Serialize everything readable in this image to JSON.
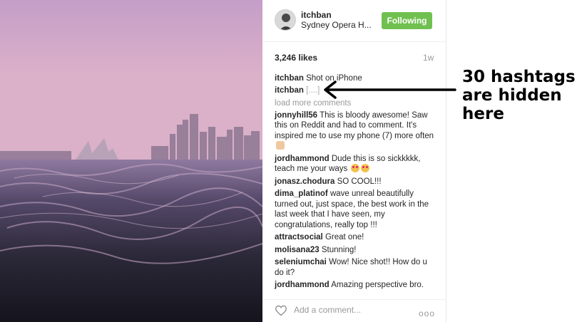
{
  "post": {
    "username": "itchban",
    "location": "Sydney Opera H...",
    "follow_label": "Following",
    "likes": "3,246 likes",
    "time": "1w",
    "caption": {
      "user": "itchban",
      "text": "Shot on iPhone"
    },
    "hashtag_comment": {
      "user": "itchban",
      "text": "[....]"
    },
    "load_more": "load more comments",
    "comments": [
      {
        "user": "jonnyhill56",
        "text": "This is bloody awesome! Saw this on Reddit and had to comment. It's inspired me to use my phone (7) more often"
      },
      {
        "user": "jordhammond",
        "text": "Dude this is so sickkkkk, teach me your ways"
      },
      {
        "user": "jonasz.chodura",
        "text": "SO COOL!!!"
      },
      {
        "user": "dima_platinof",
        "text": "wave unreal beautifully turned out, just space, the best work in the last week that I have seen, my congratulations, really top !!!"
      },
      {
        "user": "attractsocial",
        "text": "Great one!"
      },
      {
        "user": "molisana23",
        "text": "Stunning!"
      },
      {
        "user": "seleniumchai",
        "text": "Wow! Nice shot!! How do u do it?"
      },
      {
        "user": "jordhammond",
        "text": "Amazing perspective bro."
      }
    ],
    "add_comment_placeholder": "Add a comment...",
    "more_label": "ooo"
  },
  "annotation": {
    "text": "30 hashtags are hidden here"
  },
  "colors": {
    "follow_button": "#70c050",
    "muted_text": "#999999"
  },
  "icons": [
    "heart-icon",
    "arrow-icon",
    "more-options-icon"
  ]
}
